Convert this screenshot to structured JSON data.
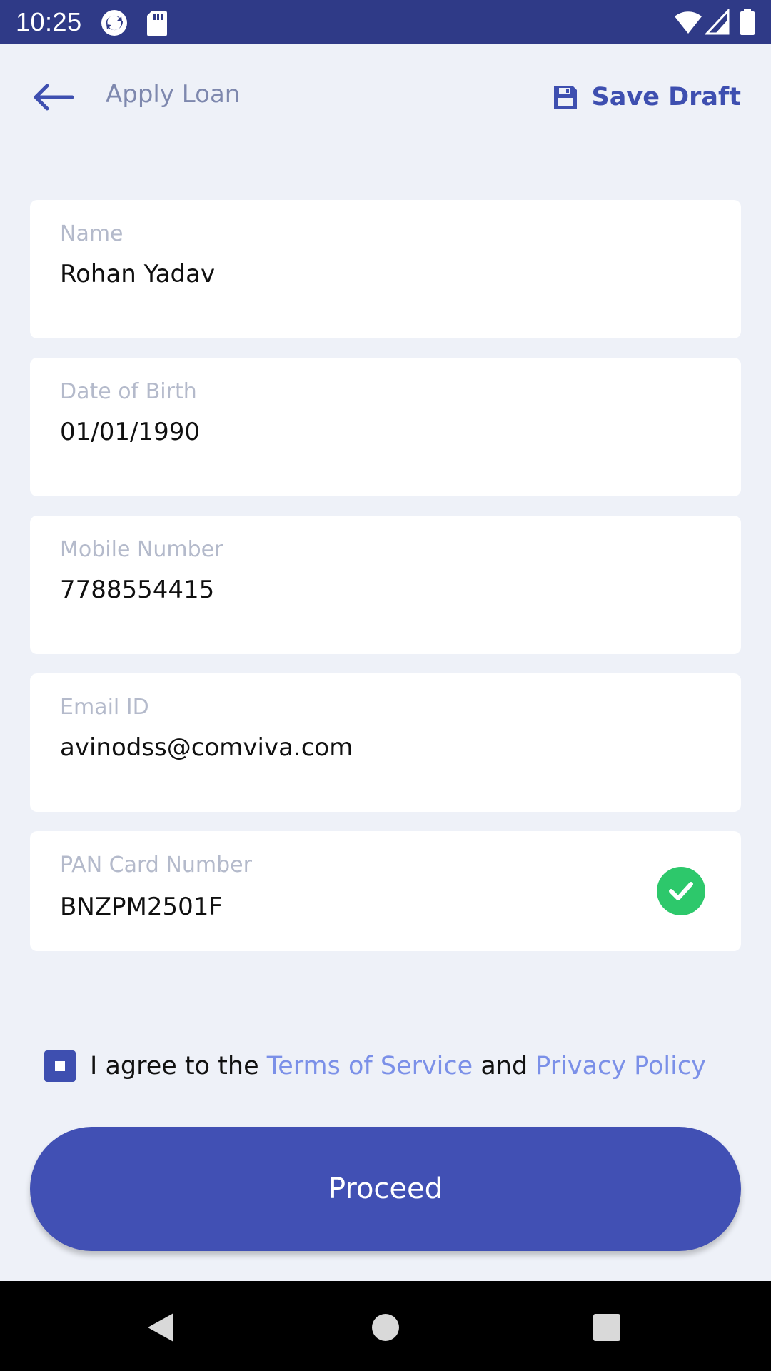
{
  "status_bar": {
    "time": "10:25",
    "left_icons": [
      "sync-icon",
      "sd-card-icon"
    ],
    "right_icons": [
      "wifi-icon",
      "cell-signal-icon",
      "battery-icon"
    ]
  },
  "app_bar": {
    "back_icon": "arrow-left-icon",
    "title": "Apply Loan",
    "save_draft_icon": "floppy-disk-icon",
    "save_draft_label": "Save Draft"
  },
  "form": {
    "fields": [
      {
        "label": "Name",
        "value": "Rohan Yadav"
      },
      {
        "label": "Date of Birth",
        "value": "01/01/1990"
      },
      {
        "label": "Mobile Number",
        "value": "7788554415"
      },
      {
        "label": "Email ID",
        "value": "avinodss@comviva.com"
      },
      {
        "label": "PAN Card Number",
        "value": "BNZPM2501F",
        "verified": true
      }
    ]
  },
  "agreement": {
    "checked": true,
    "prefix": "I agree to the ",
    "terms_link": "Terms of Service",
    "middle": " and ",
    "privacy_link": "Privacy Policy"
  },
  "proceed_label": "Proceed",
  "colors": {
    "status_bar": "#2F3A87",
    "primary": "#4150B4",
    "link": "#7B90E8",
    "background": "#EEF1F8",
    "success": "#2DC86B"
  },
  "nav_bar": {
    "icons": [
      "back-triangle-icon",
      "home-circle-icon",
      "recents-square-icon"
    ]
  }
}
